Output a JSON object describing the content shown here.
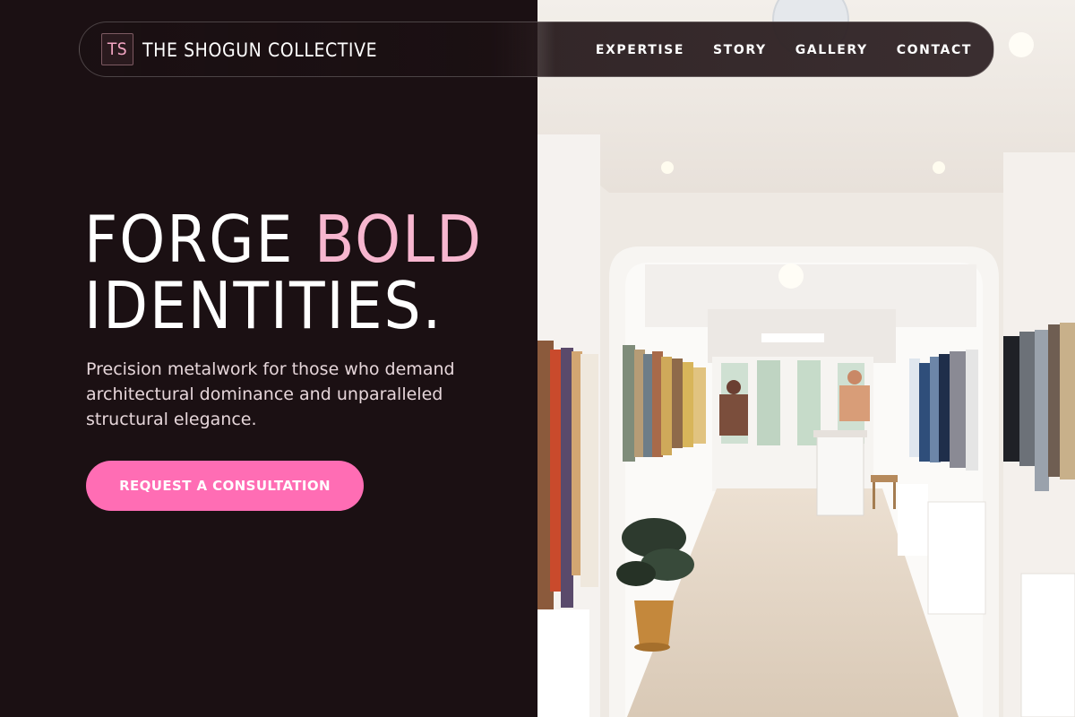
{
  "brand": {
    "logo_initials": "TS",
    "name": "THE SHOGUN COLLECTIVE"
  },
  "nav": {
    "items": [
      {
        "label": "EXPERTISE"
      },
      {
        "label": "STORY"
      },
      {
        "label": "GALLERY"
      },
      {
        "label": "CONTACT"
      }
    ]
  },
  "hero": {
    "headline_part1": "FORGE ",
    "headline_accent": "BOLD",
    "headline_line2": "IDENTITIES.",
    "subtitle": "Precision metalwork for those who demand architectural dominance and unparalleled structural elegance.",
    "cta_label": "REQUEST A CONSULTATION"
  },
  "colors": {
    "background": "#1b1013",
    "accent_pink": "#ff6db4",
    "headline_accent": "#f7b6cf"
  }
}
